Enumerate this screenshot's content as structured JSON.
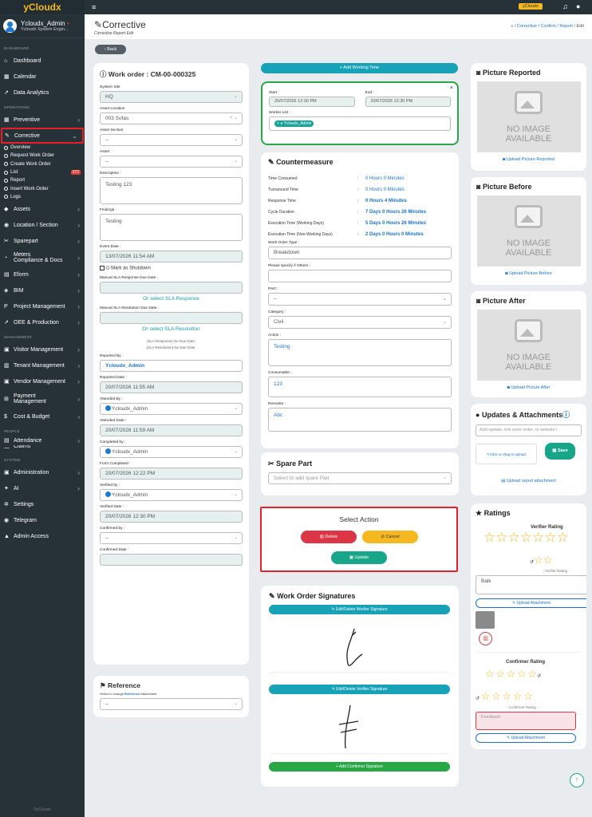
{
  "app": {
    "brand": "yCloudx",
    "user_name": "Ycloudx_Admin",
    "user_role": "Ycloudx System Engin...",
    "footer": "©yCloudx"
  },
  "sidebar": {
    "sections": {
      "dashboard": "DASHBOARD",
      "operations": "OPERATIONS",
      "management": "MANAGEMENT",
      "people": "PEOPLE",
      "system": "SYSTEM"
    },
    "items": {
      "dashboard": "Dashboard",
      "calendar": "Calendar",
      "data_analytics": "Data Analytics",
      "preventive": "Preventive",
      "corrective": "Corrective",
      "assets": "Assets",
      "location": "Location / Section",
      "sparepart": "Sparepart",
      "meters": "Meters",
      "compliance": "Compliance & Docs",
      "eform": "Eform",
      "bim": "BIM",
      "project": "Project Management",
      "oee": "OEE & Production",
      "visitor": "Visitor Management",
      "tenant": "Tenant Management",
      "vendor": "Vendor Management",
      "payment": "Payment",
      "payment2": "Management",
      "cost": "Cost & Budget",
      "attendance": "Attendance",
      "claims": "Claims",
      "administration": "Administration",
      "ai": "AI",
      "settings": "Settings",
      "telegram": "Telegram",
      "admin_access": "Admin Access"
    },
    "sub": {
      "overview": "Overview",
      "request": "Request Work Order",
      "create": "Create Work Order",
      "list": "List",
      "list_badge": "372",
      "report": "Report",
      "insert": "Insert Work Order",
      "logs": "Logs"
    }
  },
  "topbar": {
    "badge": "yCloudx"
  },
  "title": {
    "text": "Corrective",
    "subtitle": "Corrective Report Edit",
    "bc_1": "Corrective",
    "bc_2": "Confirm",
    "bc_3": "Report",
    "bc_4": "Edit"
  },
  "back_label": "Back",
  "wo": {
    "title": "Work order : CM-00-000325",
    "system_site_label": "System Site",
    "system_site": "HQ",
    "asset_location_label": "Asset Location",
    "asset_location": "003 Sofas",
    "asset_section_label": "Asset Section",
    "asset_section": "--",
    "asset_label": "Asset",
    "asset": "--",
    "description_label": "Description :",
    "description": "Testing 123",
    "findings_label": "Findings :",
    "findings": "Testing",
    "event_date_label": "Event Date :",
    "event_date": "13/07/2026 11:54 AM",
    "shutdown_label": "Mark as Shutdown",
    "sla_resp_label": "Manual SLA Response Due Date :",
    "sla_resp_link": "Or select SLA Response",
    "sla_res_label": "Manual SLA Resolution Due Date :",
    "sla_res_link": "Or select SLA Resolution",
    "sla_note_1": "(SLA Response) No Due Date.",
    "sla_note_2": "(SLA Resolution) No Due Date.",
    "reported_by_label": "Reported By :",
    "reported_by": "Ycloudx_Admin",
    "reported_date_label": "Reported Date :",
    "reported_date": "20/07/2026 11:55 AM",
    "attended_by_label": "Attended By :",
    "attended_by": "Ycloudx_Admin",
    "attended_date_label": "Attended Date :",
    "attended_date": "20/07/2026 11:59 AM",
    "completed_by_label": "Completed by :",
    "completed_by": "Ycloudx_Admin",
    "form_completed_label": "Form Completed :",
    "form_completed": "20/07/2026 12:22 PM",
    "verified_by_label": "Verified by :",
    "verified_by": "Ycloudx_Admin",
    "verified_date_label": "Verified Date :",
    "verified_date": "20/07/2026 12:30 PM",
    "confirmed_by_label": "Confirmed by :",
    "confirmed_by": "--",
    "confirmed_date_label": "Confirmed Date :"
  },
  "reference": {
    "title": "Reference",
    "hint_pre": "Select to change ",
    "hint_bold": "Reference",
    "hint_post": " Attachment",
    "value": "--"
  },
  "working": {
    "add_label": "Add Working Time",
    "start_label": "Start :",
    "start": "20/07/2026 12:30 PM",
    "end_label": "End :",
    "end": "20/07/2026 12:30 PM",
    "worker_label": "Worker List :",
    "worker": "Ycloudx_Admin"
  },
  "counter": {
    "title": "Countermeasure",
    "rows": [
      {
        "k": "Time Consumed",
        "v": "0 Hours 0 Minutes"
      },
      {
        "k": "Turnaround Time",
        "v": "0 Hours 0 Minutes"
      },
      {
        "k": "Response Time",
        "v": "0 Hours 4 Minutes"
      },
      {
        "k": "Cycle Duration",
        "v": "7 Days 0 Hours 26 Minutes"
      },
      {
        "k": "Execution Time (Working Days)",
        "v": "5 Days 0 Hours 26 Minutes"
      },
      {
        "k": "Execution Time (Non-Working Days)",
        "v": "2 Days 0 Hours 0 Minutes"
      }
    ],
    "wo_type_label": "Work Order Type :",
    "wo_type": "Breakdown",
    "specify_label": "Please specify if Others :",
    "paic_label": "PAIC :",
    "paic": "--",
    "category_label": "Category :",
    "category": "Civil",
    "action_label": "Action :",
    "action": "Testing",
    "consumable_label": "Consumable :",
    "consumable": "123",
    "remarks_label": "Remarks :",
    "remarks": "Abc"
  },
  "spare": {
    "title": "Spare Part",
    "placeholder": "Select to add spare Part"
  },
  "select_action": {
    "title": "Select Action",
    "delete": "Delete",
    "cancel": "Cancel",
    "update": "Update"
  },
  "signatures": {
    "title": "Work Order Signatures",
    "worker_btn": "Edit/Delete Worker Signature",
    "verifier_btn": "Edit/Delete Verifier Signature",
    "confirmer_btn": "Add Confirmer Signature"
  },
  "pictures": {
    "reported_title": "Picture Reported",
    "reported_upload": "Upload Picture Reported",
    "before_title": "Picture Before",
    "before_upload": "Upload Picture Before",
    "after_title": "Picture After",
    "after_upload": "Upload Picture After",
    "no_image_1": "NO IMAGE",
    "no_image_2": "AVAILABLE"
  },
  "updates": {
    "title": "Updates & Attachments",
    "placeholder": "Add update, link work order, or website l",
    "drop": "Click or drag to upload",
    "save": "Save",
    "report_attach": "Upload report attachment"
  },
  "ratings": {
    "title": "Ratings",
    "verifier": "Verifier Rating",
    "verifier_sub": "- Verifier Rating -",
    "verifier_text": "Balk",
    "upload": "Upload Attachment",
    "confirmer": "Confirmer Rating",
    "confirmer_sub": "- Confirmer Rating -",
    "feedback": "Feedback"
  }
}
